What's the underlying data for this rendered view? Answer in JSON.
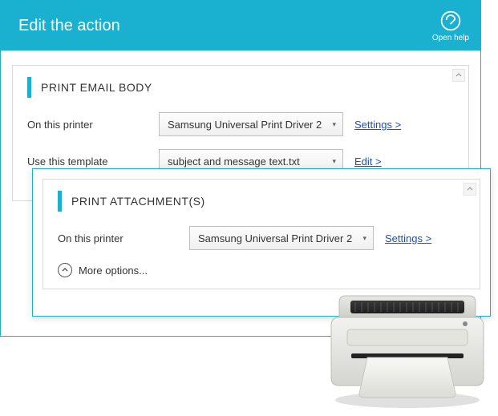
{
  "colors": {
    "accent": "#19b1cf",
    "link": "#1450c8"
  },
  "titlebar": {
    "title": "Edit the action",
    "help_label": "Open help"
  },
  "panel_body": {
    "title": "PRINT EMAIL BODY",
    "row1": {
      "label": "On this printer",
      "value": "Samsung Universal Print Driver 2",
      "link": "Settings >"
    },
    "row2": {
      "label": "Use this template",
      "value": "subject and message text.txt",
      "link": "Edit >"
    }
  },
  "panel_attach": {
    "title": "PRINT ATTACHMENT(S)",
    "row1": {
      "label": "On this printer",
      "value": "Samsung Universal Print Driver 2",
      "link": "Settings >"
    },
    "more": "More options..."
  }
}
